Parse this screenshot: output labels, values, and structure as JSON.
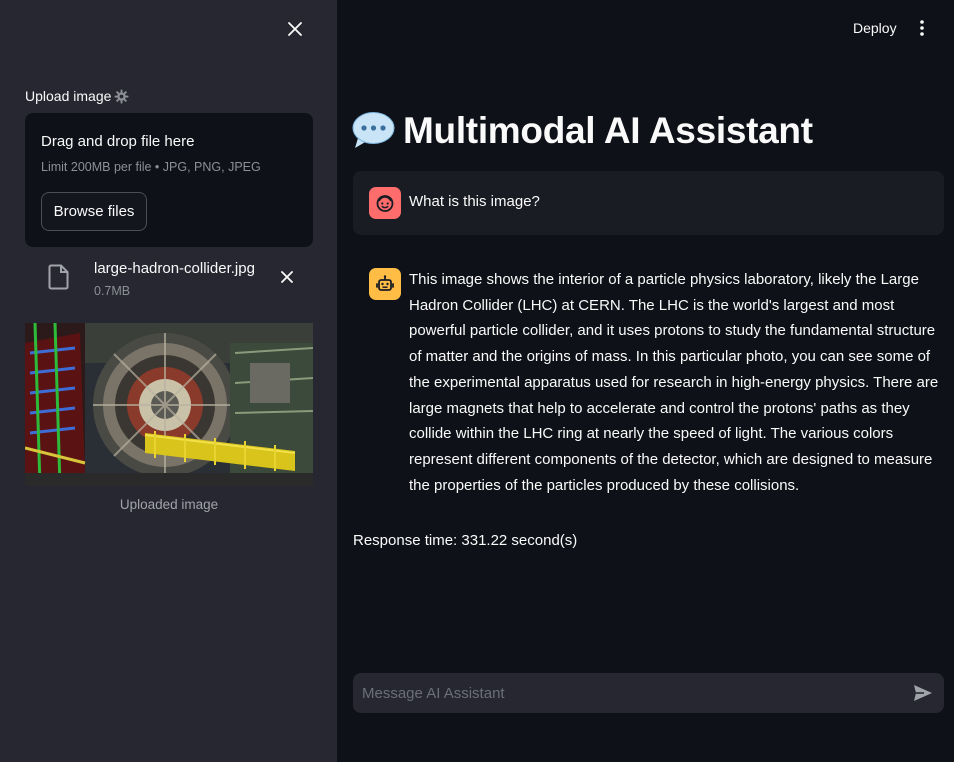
{
  "sidebar": {
    "upload_label": "Upload image",
    "dropzone": {
      "title": "Drag and drop file here",
      "subtitle": "Limit 200MB per file • JPG, PNG, JPEG",
      "browse_label": "Browse files"
    },
    "file": {
      "name": "large-hadron-collider.jpg",
      "size": "0.7MB"
    },
    "image_caption": "Uploaded image"
  },
  "header": {
    "deploy_label": "Deploy"
  },
  "main": {
    "title": "Multimodal AI Assistant",
    "title_icon": "speech-balloon-icon",
    "messages": [
      {
        "role": "user",
        "avatar_icon": "user-face-icon",
        "text": "What is this image?"
      },
      {
        "role": "assistant",
        "avatar_icon": "robot-face-icon",
        "text": "This image shows the interior of a particle physics laboratory, likely the Large Hadron Collider (LHC) at CERN. The LHC is the world's largest and most powerful particle collider, and it uses protons to study the fundamental structure of matter and the origins of mass. In this particular photo, you can see some of the experimental apparatus used for research in high-energy physics. There are large magnets that help to accelerate and control the protons' paths as they collide within the LHC ring at nearly the speed of light. The various colors represent different components of the detector, which are designed to measure the properties of the particles produced by these collisions."
      }
    ],
    "response_time": "Response time: 331.22 second(s)",
    "chat_input": {
      "placeholder": "Message AI Assistant",
      "value": ""
    }
  },
  "colors": {
    "background": "#0e1117",
    "sidebar": "#262730",
    "user_avatar": "#ff6c6c",
    "bot_avatar": "#ffbd45",
    "chat_bubble": "#1a1c24"
  }
}
